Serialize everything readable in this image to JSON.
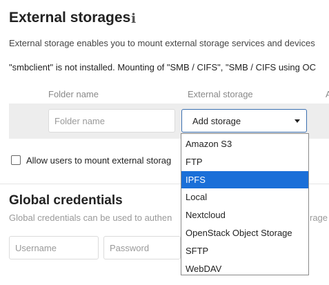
{
  "external_storages": {
    "title": "External storages",
    "info_icon": "info-icon",
    "description": "External storage enables you to mount external storage services and devices",
    "warning": "\"smbclient\" is not installed. Mounting of \"SMB / CIFS\", \"SMB / CIFS using OC",
    "columns": {
      "folder_name": "Folder name",
      "external_storage": "External storage",
      "extra": "A"
    },
    "new_row": {
      "folder_placeholder": "Folder name",
      "storage_select_value": "Add storage"
    },
    "storage_options": [
      {
        "label": "Amazon S3",
        "selected": false
      },
      {
        "label": "FTP",
        "selected": false
      },
      {
        "label": "IPFS",
        "selected": true
      },
      {
        "label": "Local",
        "selected": false
      },
      {
        "label": "Nextcloud",
        "selected": false
      },
      {
        "label": "OpenStack Object Storage",
        "selected": false
      },
      {
        "label": "SFTP",
        "selected": false
      },
      {
        "label": "WebDAV",
        "selected": false
      }
    ],
    "allow_users_label": "Allow users to mount external storag",
    "allow_users_checked": false
  },
  "global_credentials": {
    "title": "Global credentials",
    "description": "Global credentials can be used to authen",
    "description_tail": "rage",
    "username_placeholder": "Username",
    "password_placeholder": "Password"
  },
  "colors": {
    "accent": "#1a6fd8",
    "select_border": "#3a6fb0",
    "row_background": "#ededed"
  }
}
